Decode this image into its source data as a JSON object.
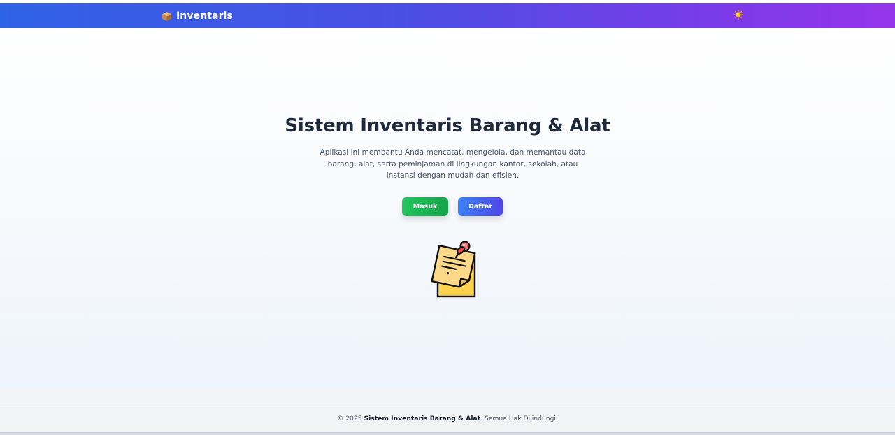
{
  "navbar": {
    "brand_icon": "package-box-icon",
    "brand_title": "Inventaris",
    "theme_toggle_icon": "sun-icon",
    "gradient_colors": [
      "#2f63e6",
      "#4a4fe3",
      "#7a3be8",
      "#9535ea"
    ]
  },
  "hero": {
    "title": "Sistem Inventaris Barang & Alat",
    "description_lines": [
      "Aplikasi ini membantu Anda mencatat, mengelola, dan memantau data",
      "barang, alat, serta peminjaman di lingkungan kantor, sekolah, atau",
      "instansi dengan mudah dan efisien."
    ],
    "buttons": {
      "login_label": "Masuk",
      "register_label": "Daftar"
    },
    "illustration_icon": "pinned-memo-icon"
  },
  "footer": {
    "prefix": "© 2025 ",
    "app_name": "Sistem Inventaris Barang & Alat",
    "suffix": ". Semua Hak Dilindungi."
  },
  "colors": {
    "login_button": "#22c55e",
    "register_button": "#4f46e5",
    "title_text": "#1e293b"
  }
}
